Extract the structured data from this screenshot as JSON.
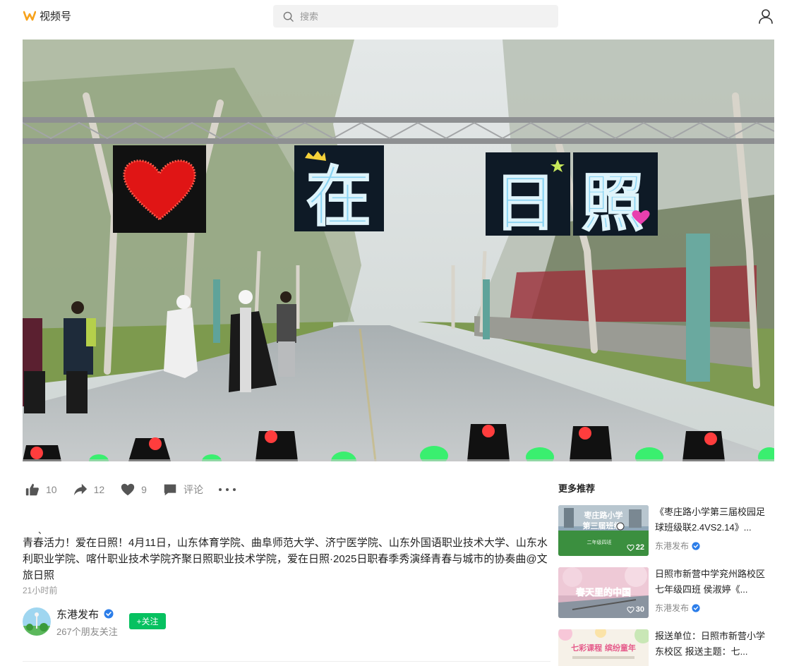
{
  "header": {
    "app_name": "视频号",
    "search_placeholder": "搜索"
  },
  "video": {
    "banner": [
      "在",
      "日",
      "照"
    ]
  },
  "actions": {
    "likes": "10",
    "shares": "12",
    "favorites": "9",
    "comment_label": "评论"
  },
  "post": {
    "mark": "、",
    "description": "青春活力！爱在日照！4月11日，山东体育学院、曲阜师范大学、济宁医学院、山东外国语职业技术大学、山东水利职业学院、喀什职业技术学院齐聚日照职业技术学院，爱在日照·2025日职春季秀演绎青春与城市的协奏曲@文旅日照",
    "time": "21小时前"
  },
  "author": {
    "name": "东港发布",
    "followers": "267个朋友关注",
    "follow_label": "+关注"
  },
  "sidebar": {
    "title": "更多推荐",
    "items": [
      {
        "title": "《枣庄路小学第三届校园足球班级联2.4VS2.14》...",
        "author": "东港发布",
        "likes": "22",
        "thumb_text": "枣庄路小学",
        "thumb_text2": "第三届班级",
        "thumb_caption": "二年级四班"
      },
      {
        "title": "日照市新营中学兖州路校区七年级四班 侯淑婷《...",
        "author": "东港发布",
        "likes": "30",
        "thumb_text": "春天里的中国"
      },
      {
        "title": "报送单位：日照市新营小学东校区 报送主题：七...",
        "author": "",
        "likes": "",
        "thumb_text": "七彩课程  缤纷童年"
      }
    ]
  },
  "colors": {
    "brand_orange": "#f7a21b",
    "follow_green": "#07c160",
    "verified_blue": "#2b7de9"
  }
}
